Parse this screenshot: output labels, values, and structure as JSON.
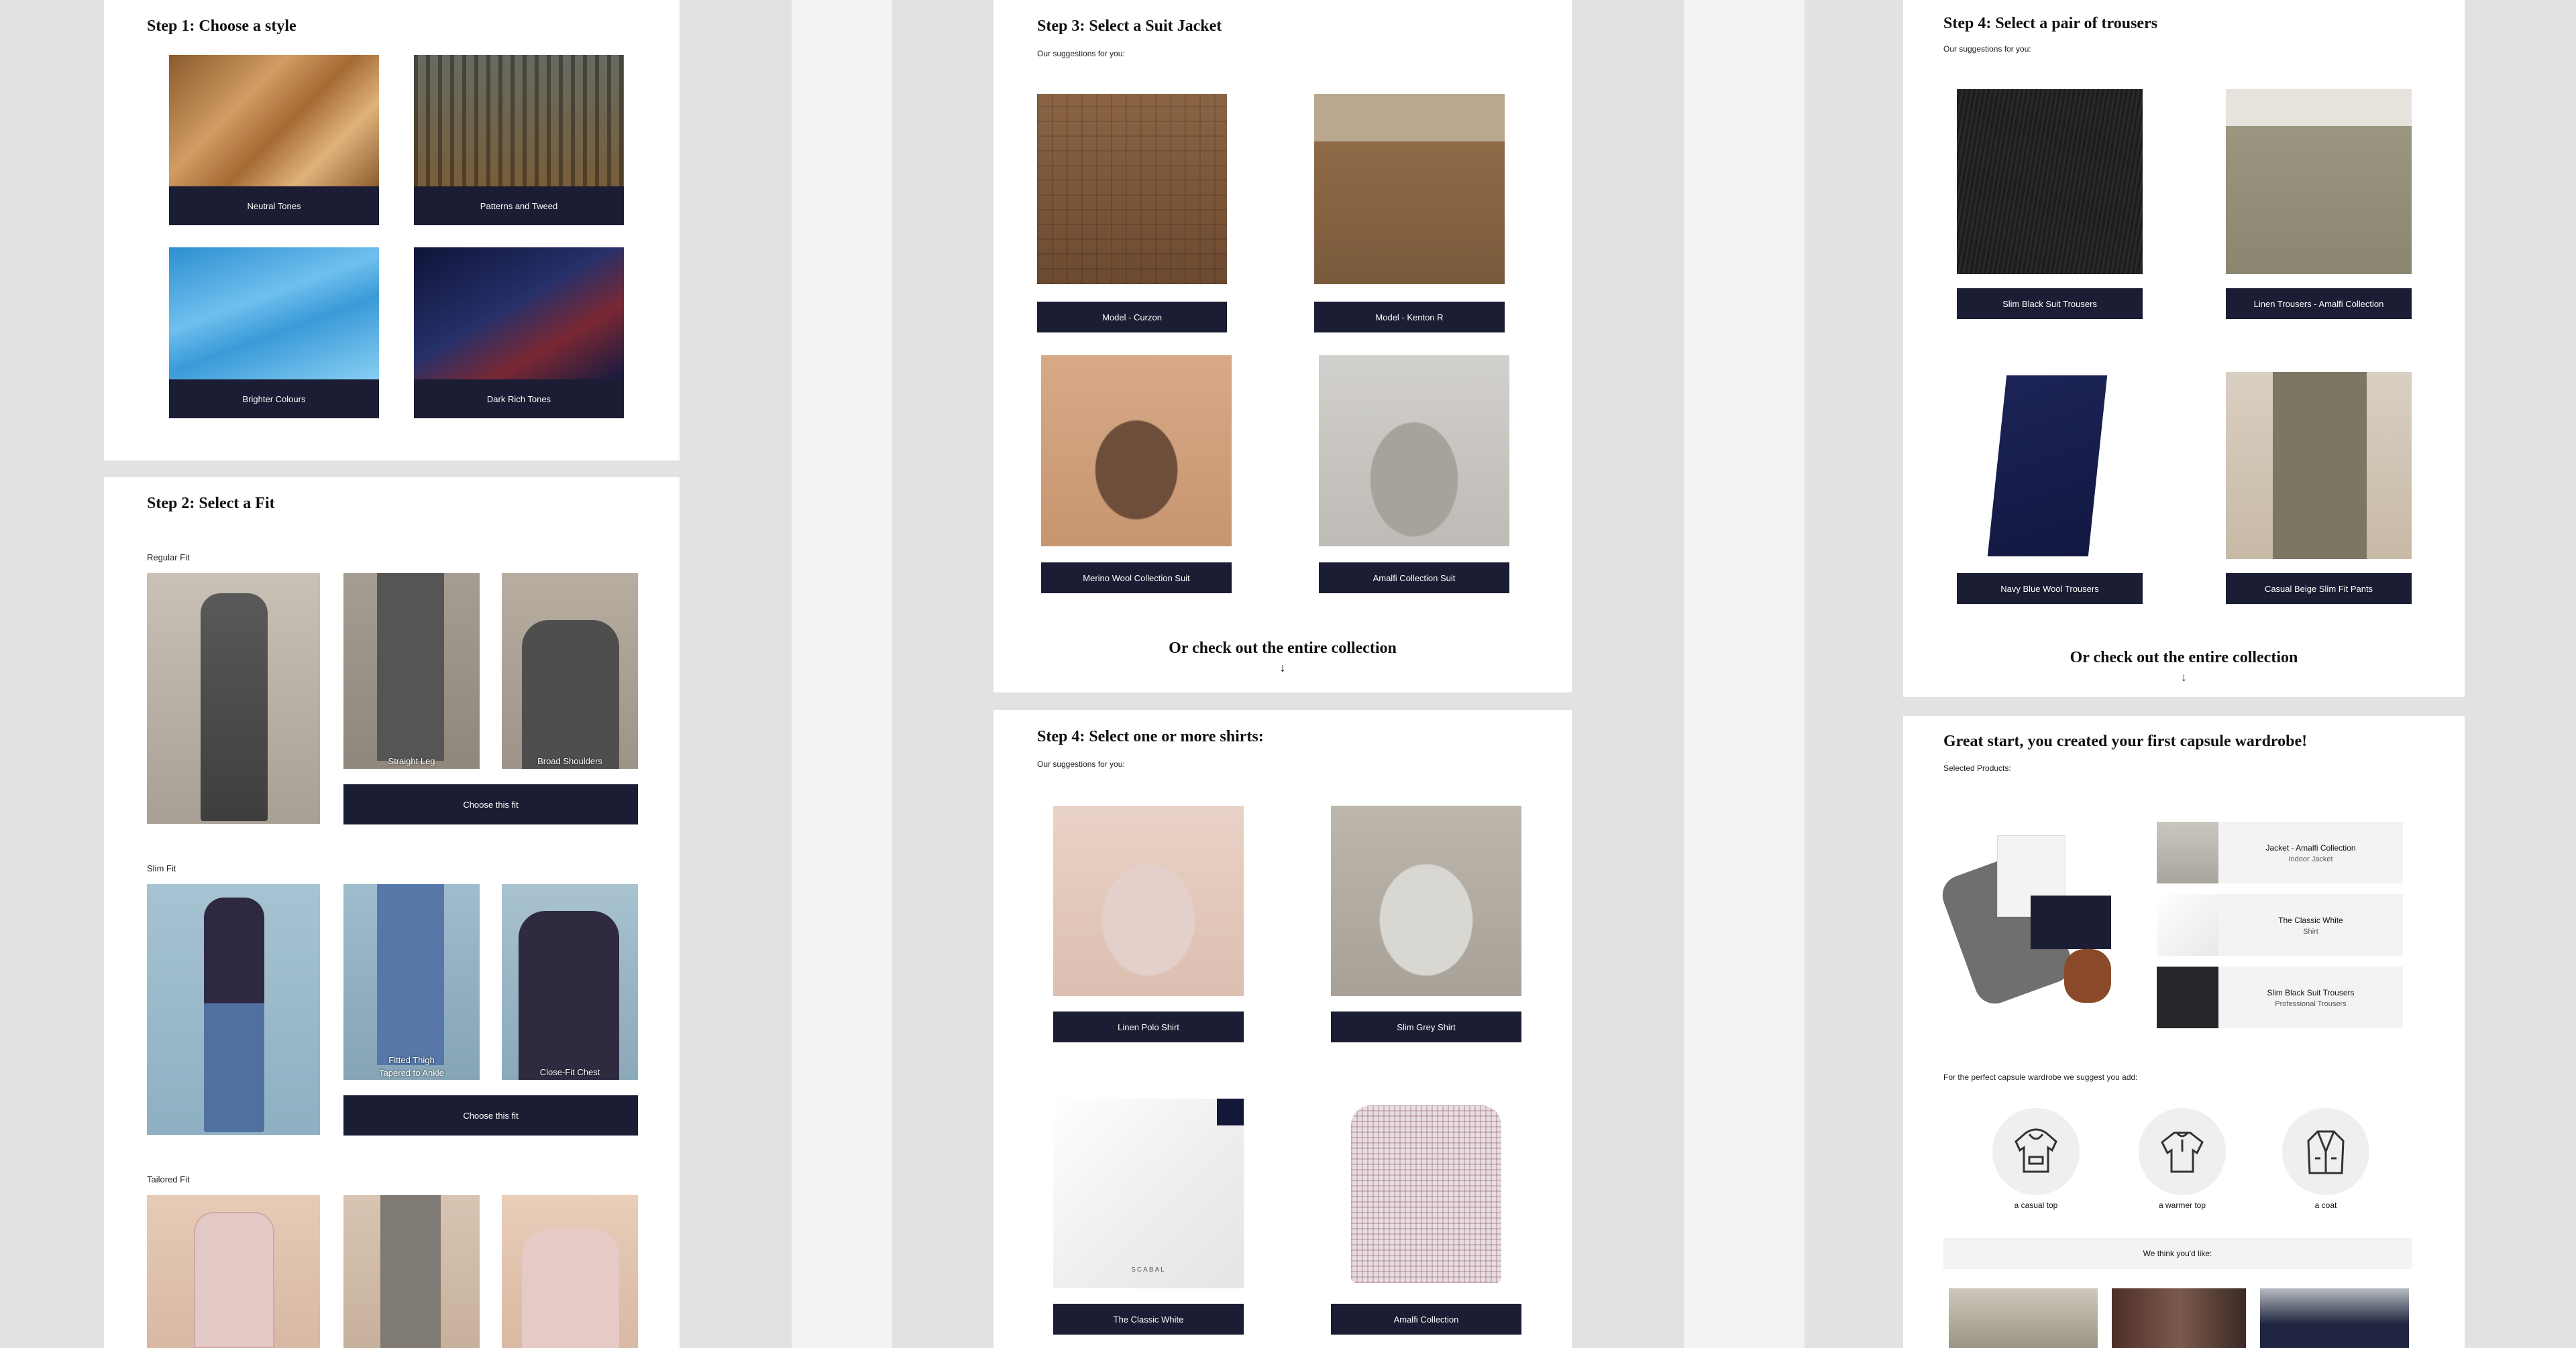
{
  "colors": {
    "navy": "#1a1d33",
    "page_bg": "#f3f3f3",
    "card_bg": "#ffffff"
  },
  "step1": {
    "title": "Step 1: Choose a style",
    "tiles": [
      "Neutral Tones",
      "Patterns and Tweed",
      "Brighter Colours",
      "Dark Rich Tones"
    ]
  },
  "step2": {
    "title": "Step 2: Select a Fit",
    "regular": {
      "label": "Regular Fit",
      "detail1": "Straight Leg",
      "detail2": "Broad Shoulders",
      "button": "Choose this fit"
    },
    "slim": {
      "label": "Slim Fit",
      "detail1_line1": "Fitted Thigh",
      "detail1_line2": "Tapered to Ankle",
      "detail2": "Close-Fit Chest",
      "button": "Choose this fit"
    },
    "tailored": {
      "label": "Tailored Fit"
    }
  },
  "step3": {
    "title": "Step 3: Select a Suit Jacket",
    "subtitle": "Our suggestions for you:",
    "items": [
      "Model - Curzon",
      "Model - Kenton R",
      "Merino Wool Collection Suit",
      "Amalfi Collection Suit"
    ],
    "cta": "Or check out the entire collection",
    "arrow": "↓"
  },
  "step4_shirts": {
    "title": "Step 4: Select one or more shirts:",
    "subtitle": "Our suggestions for you:",
    "items": [
      "Linen Polo Shirt",
      "Slim Grey Shirt",
      "The Classic White",
      "Amalfi Collection"
    ],
    "brand_mark": "SCABAL"
  },
  "step4_trousers": {
    "title": "Step 4: Select a pair of trousers",
    "subtitle": "Our suggestions for you:",
    "items": [
      "Slim Black Suit Trousers",
      "Linen Trousers - Amalfi Collection",
      "Navy Blue Wool Trousers",
      "Casual Beige Slim Fit Pants"
    ],
    "cta": "Or check out the entire collection",
    "arrow": "↓"
  },
  "summary": {
    "title": "Great start, you created your first capsule wardrobe!",
    "selected_label": "Selected Products:",
    "products": [
      {
        "name": "Jacket - Amalfi Collection",
        "type": "Indoor Jacket"
      },
      {
        "name": "The Classic White",
        "type": "Shirt"
      },
      {
        "name": "Slim Black Suit Trousers",
        "type": "Professional Trousers"
      }
    ],
    "suggest_label": "For the perfect capsule wardrobe we suggest you add:",
    "suggestions": [
      {
        "label": "a casual top",
        "icon": "hoodie-icon"
      },
      {
        "label": "a warmer top",
        "icon": "sweater-icon"
      },
      {
        "label": "a coat",
        "icon": "coat-icon"
      }
    ],
    "like_label": "We think you'd like:"
  }
}
